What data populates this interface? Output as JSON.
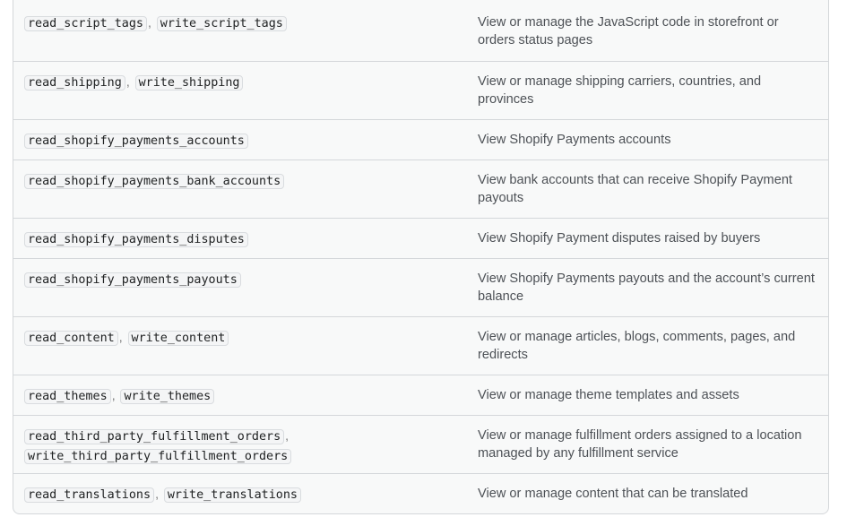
{
  "rows": [
    {
      "scopes": [
        "read_script_tags",
        "write_script_tags"
      ],
      "description": "View or manage the JavaScript code in storefront or orders status pages"
    },
    {
      "scopes": [
        "read_shipping",
        "write_shipping"
      ],
      "description": "View or manage shipping carriers, countries, and provinces"
    },
    {
      "scopes": [
        "read_shopify_payments_accounts"
      ],
      "description": "View Shopify Payments accounts"
    },
    {
      "scopes": [
        "read_shopify_payments_bank_accounts"
      ],
      "description": "View bank accounts that can receive Shopify Payment payouts"
    },
    {
      "scopes": [
        "read_shopify_payments_disputes"
      ],
      "description": "View Shopify Payment disputes raised by buyers"
    },
    {
      "scopes": [
        "read_shopify_payments_payouts"
      ],
      "description": "View Shopify Payments payouts and the account’s current balance"
    },
    {
      "scopes": [
        "read_content",
        "write_content"
      ],
      "description": "View or manage articles, blogs, comments, pages, and redirects"
    },
    {
      "scopes": [
        "read_themes",
        "write_themes"
      ],
      "description": "View or manage theme templates and assets"
    },
    {
      "scopes": [
        "read_third_party_fulfillment_orders",
        "write_third_party_fulfillment_orders"
      ],
      "description": "View or manage fulfillment orders assigned to a location managed by any fulfillment service"
    },
    {
      "scopes": [
        "read_translations",
        "write_translations"
      ],
      "description": "View or manage content that can be translated"
    }
  ],
  "separator": ","
}
